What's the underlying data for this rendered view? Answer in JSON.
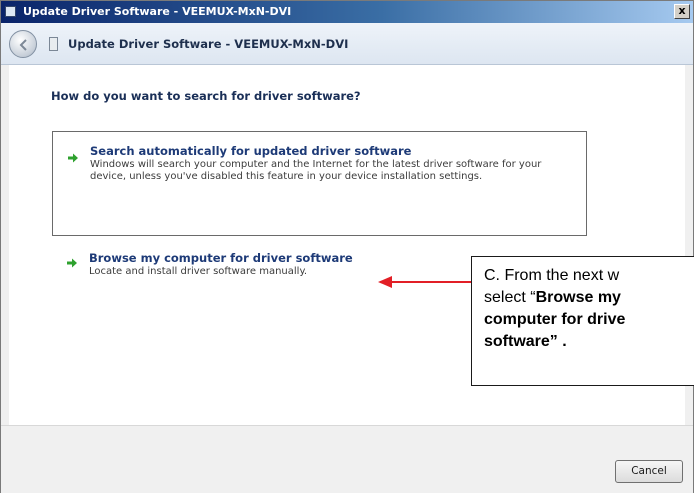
{
  "window": {
    "title": "Update Driver Software - VEEMUX-MxN-DVI",
    "close_label": "x"
  },
  "navbar": {
    "title": "Update Driver Software - VEEMUX-MxN-DVI"
  },
  "main": {
    "question": "How do you want to search for driver software?",
    "options": [
      {
        "title": "Search automatically for updated driver software",
        "description_line1": "Windows will search your computer and the Internet for the latest driver software for your",
        "description_line2": "device, unless you've disabled this feature in your device installation settings."
      },
      {
        "title": "Browse my computer for driver software",
        "description": "Locate and install driver software manually."
      }
    ]
  },
  "callout": {
    "line1": "C. From the next w",
    "line2_prefix": "select “",
    "line2_bold": "Browse my",
    "line3": "computer for drive",
    "line4": "software” ."
  },
  "footer": {
    "cancel_label": "Cancel"
  },
  "colors": {
    "arrow_green": "#2ea12e",
    "pointer_red": "#e21f26",
    "title_blue": "#1d3a77"
  }
}
